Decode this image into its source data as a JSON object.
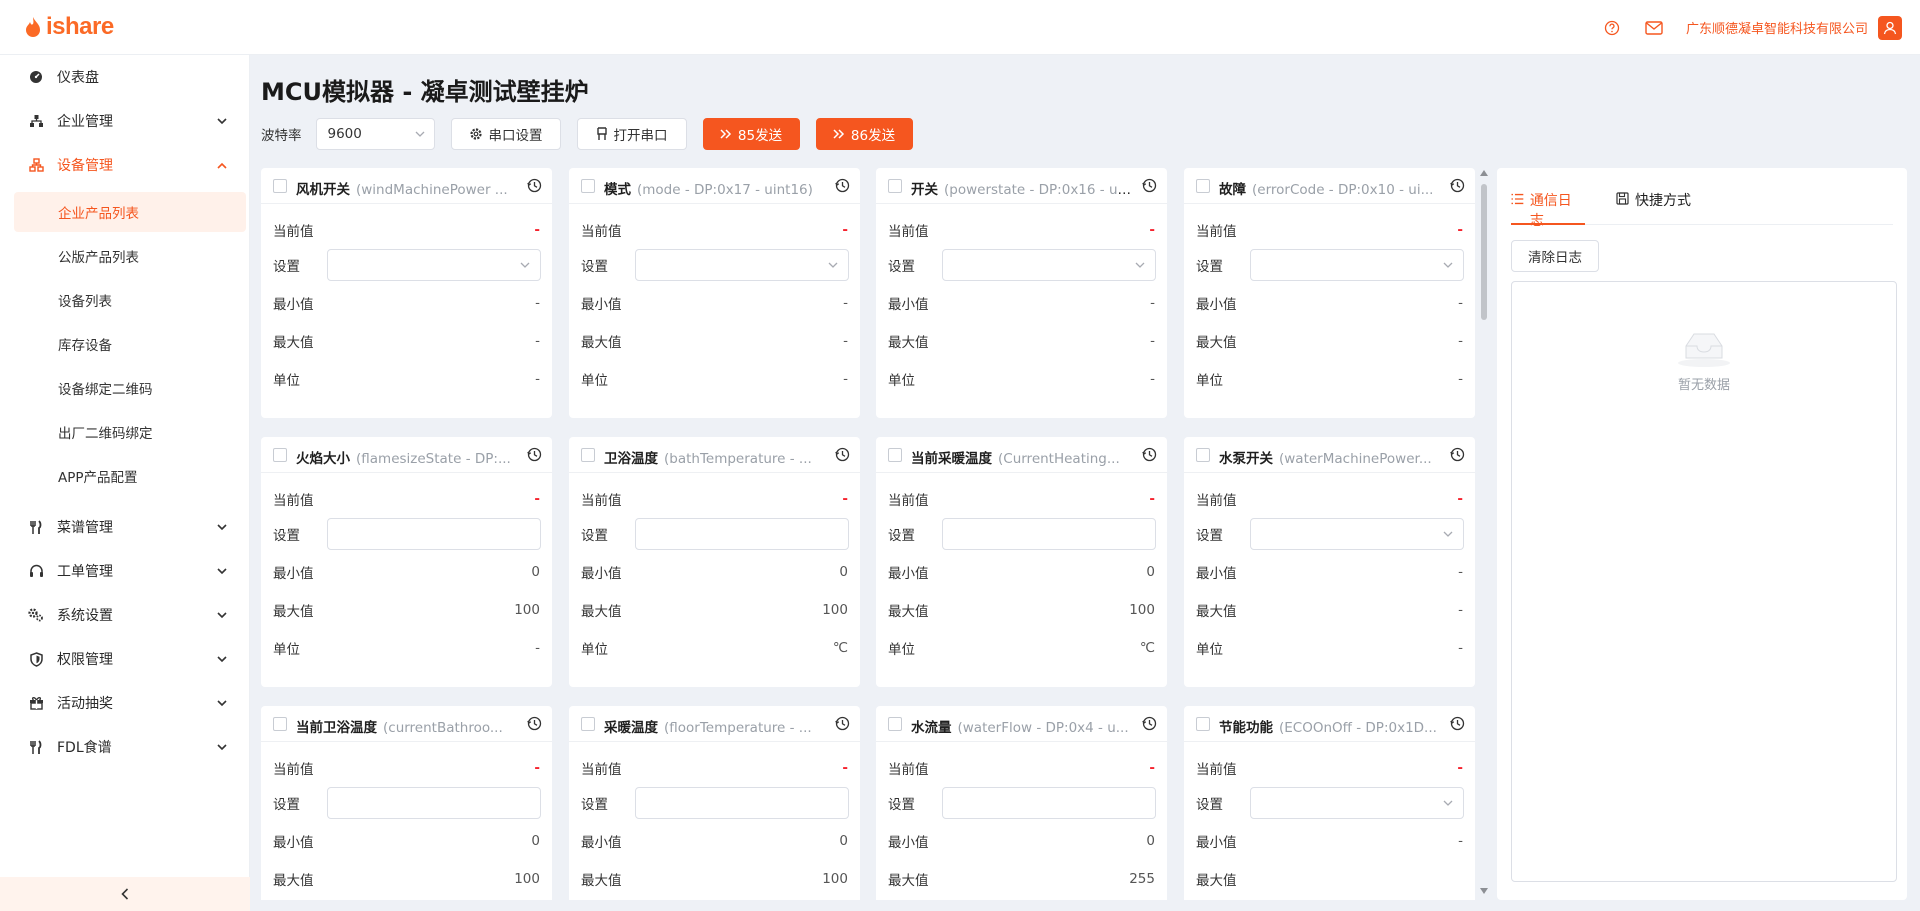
{
  "brand": {
    "name": "ishare",
    "color": "#f5561f"
  },
  "header": {
    "company": "广东顺德凝卓智能科技有限公司",
    "help_icon": "question-circle-icon",
    "mail_icon": "mail-icon",
    "user_icon": "user-icon"
  },
  "sidebar": {
    "menu": [
      {
        "label": "仪表盘",
        "icon": "dashboard-icon"
      },
      {
        "label": "企业管理",
        "icon": "org-icon"
      },
      {
        "label": "设备管理",
        "icon": "device-icon"
      },
      {
        "label": "菜谱管理",
        "icon": "fork-knife-icon"
      },
      {
        "label": "工单管理",
        "icon": "headset-icon"
      },
      {
        "label": "系统设置",
        "icon": "gears-icon"
      },
      {
        "label": "权限管理",
        "icon": "shield-icon"
      },
      {
        "label": "活动抽奖",
        "icon": "gift-icon"
      },
      {
        "label": "FDL食谱",
        "icon": "fork-knife-icon"
      }
    ],
    "device_sub": [
      "企业产品列表",
      "公版产品列表",
      "设备列表",
      "库存设备",
      "设备绑定二维码",
      "出厂二维码绑定",
      "APP产品配置"
    ]
  },
  "page": {
    "title": "MCU模拟器 - 凝卓测试壁挂炉"
  },
  "toolbar": {
    "baud_label": "波特率",
    "baud_value": "9600",
    "serial_settings": "串口设置",
    "open_port": "打开串口",
    "send_85": "85发送",
    "send_86": "86发送"
  },
  "field_labels": {
    "current": "当前值",
    "set": "设置",
    "min": "最小值",
    "max": "最大值",
    "unit": "单位"
  },
  "cards": [
    {
      "name": "风机开关",
      "dp": "(windMachinePower ...",
      "current": "-",
      "input": "select",
      "min": "-",
      "max": "-",
      "unit": "-"
    },
    {
      "name": "模式",
      "dp": "(mode - DP:0x17 - uint16)",
      "current": "-",
      "input": "select",
      "min": "-",
      "max": "-",
      "unit": "-"
    },
    {
      "name": "开关",
      "dp": "(powerstate - DP:0x16 - ui...",
      "current": "-",
      "input": "select",
      "min": "-",
      "max": "-",
      "unit": "-"
    },
    {
      "name": "故障",
      "dp": "(errorCode - DP:0x10 - ui...",
      "current": "-",
      "input": "select",
      "min": "-",
      "max": "-",
      "unit": "-"
    },
    {
      "name": "火焰大小",
      "dp": "(flamesizeState - DP:...",
      "current": "-",
      "input": "text",
      "min": "0",
      "max": "100",
      "unit": "-"
    },
    {
      "name": "卫浴温度",
      "dp": "(bathTemperature - ...",
      "current": "-",
      "input": "text",
      "min": "0",
      "max": "100",
      "unit": "℃"
    },
    {
      "name": "当前采暖温度",
      "dp": "(CurrentHeating...",
      "current": "-",
      "input": "text",
      "min": "0",
      "max": "100",
      "unit": "℃"
    },
    {
      "name": "水泵开关",
      "dp": "(waterMachinePower...",
      "current": "-",
      "input": "select",
      "min": "-",
      "max": "-",
      "unit": "-"
    },
    {
      "name": "当前卫浴温度",
      "dp": "(currentBathroo...",
      "current": "-",
      "input": "text",
      "min": "0",
      "max": "100",
      "unit": ""
    },
    {
      "name": "采暖温度",
      "dp": "(floorTemperature - ...",
      "current": "-",
      "input": "text",
      "min": "0",
      "max": "100",
      "unit": ""
    },
    {
      "name": "水流量",
      "dp": "(waterFlow - DP:0x4 - u...",
      "current": "-",
      "input": "text",
      "min": "0",
      "max": "255",
      "unit": ""
    },
    {
      "name": "节能功能",
      "dp": "(ECOOnOff - DP:0x1D...",
      "current": "-",
      "input": "select",
      "min": "-",
      "max": "",
      "unit": ""
    }
  ],
  "log_panel": {
    "tab_log": "通信日志",
    "tab_shortcut": "快捷方式",
    "clear_label": "清除日志",
    "empty_text": "暂无数据"
  }
}
